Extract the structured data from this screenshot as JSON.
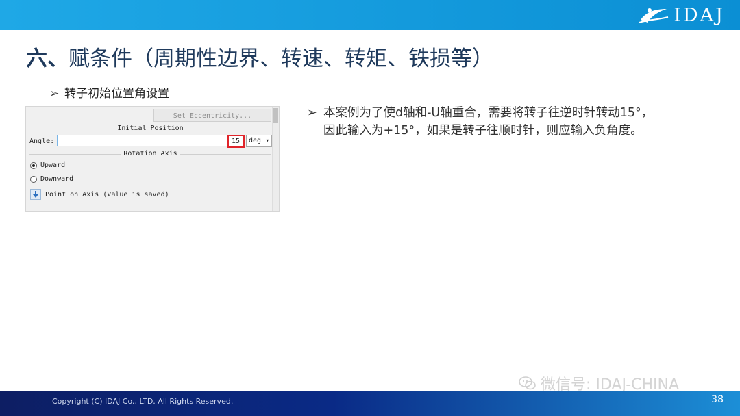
{
  "header": {
    "logo_text": "IDAJ"
  },
  "slide": {
    "title_num": "六、",
    "title_text": "赋条件（周期性边界、转速、转矩、铁损等）",
    "sub_bullet": "转子初始位置角设置",
    "desc_line1": "本案例为了使d轴和-U轴重合，需要将转子往逆时针转动15°，",
    "desc_line2": "因此输入为+15°，如果是转子往顺时针，则应输入负角度。"
  },
  "panel": {
    "set_eccentricity_label": "Set Eccentricity...",
    "initial_position_header": "Initial Position",
    "angle_label": "Angle:",
    "angle_value": "15",
    "angle_unit": "deg",
    "rotation_axis_header": "Rotation Axis",
    "radio_upward": "Upward",
    "radio_downward": "Downward",
    "point_on_axis_label": "Point on Axis (Value is saved)",
    "selected_radio": "Upward"
  },
  "watermark": {
    "text": "微信号: IDAJ-CHINA"
  },
  "footer": {
    "copyright": "Copyright (C) IDAJ Co., LTD. All Rights Reserved.",
    "page_number": "38"
  },
  "colors": {
    "header_blue": "#1fa8e6",
    "title_navy": "#1f3a5c",
    "highlight_red": "#e0242a",
    "footer_dark": "#0d1e63"
  }
}
